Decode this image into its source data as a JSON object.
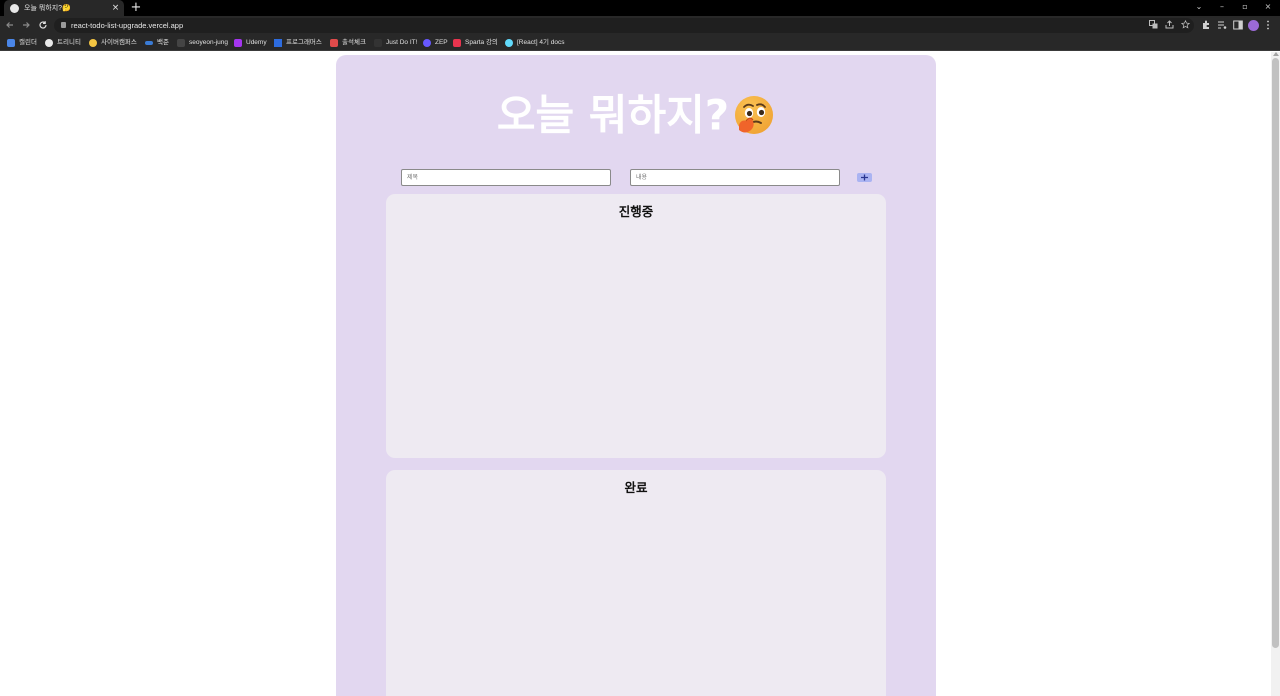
{
  "browser": {
    "tab": {
      "title": "오늘 뭐하지?🤔",
      "close": "×"
    },
    "new_tab": "+",
    "url": "react-todo-list-upgrade.vercel.app",
    "window_controls": {
      "dropdown": "⌄",
      "minimize": "–",
      "restore": "▫",
      "close": "×"
    },
    "bookmarks": [
      {
        "label": "캘린더",
        "color": "#4a86e8"
      },
      {
        "label": "트리니티",
        "color": "#e8e8e8"
      },
      {
        "label": "사이버캠퍼스",
        "color": "#f4c542"
      },
      {
        "label": "백준",
        "color": "#3a7bd5"
      },
      {
        "label": "seoyeon-jung",
        "color": "#444444"
      },
      {
        "label": "Udemy",
        "color": "#a435f0"
      },
      {
        "label": "프로그래머스",
        "color": "#2d6cdf"
      },
      {
        "label": "출석체크",
        "color": "#e04b4b"
      },
      {
        "label": "Just Do IT!",
        "color": "#333333"
      },
      {
        "label": "ZEP",
        "color": "#6758ff"
      },
      {
        "label": "Sparta 강의",
        "color": "#e8344e"
      },
      {
        "label": "[React] 4기 docs",
        "color": "#61dafb"
      }
    ]
  },
  "app": {
    "title": "오늘 뭐하지?",
    "title_emoji": "thinking-face",
    "form": {
      "title_placeholder": "제목",
      "content_placeholder": "내용",
      "add_button": "add"
    },
    "sections": {
      "in_progress": {
        "title": "진행중"
      },
      "done": {
        "title": "완료"
      }
    }
  },
  "colors": {
    "app_background": "#e2d7f0",
    "section_background": "#eeeaf2",
    "add_button": "#aab3f2",
    "title_text": "#ffffff"
  }
}
